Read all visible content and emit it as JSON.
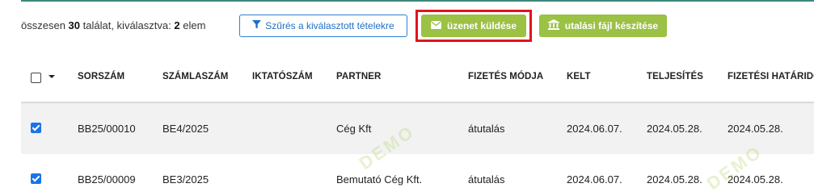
{
  "summary": {
    "prefix": "összesen",
    "total": "30",
    "middle": "találat, kiválasztva:",
    "selected": "2",
    "suffix": "elem"
  },
  "toolbar": {
    "filter_label": "Szűrés a kiválasztott tételekre",
    "filter_icon": "filter-icon",
    "message_label": "üzenet küldése",
    "message_icon": "envelope-icon",
    "file_label": "utalási fájl készítése",
    "file_icon": "bank-icon"
  },
  "table": {
    "headers": [
      "SORSZÁM",
      "SZÁMLASZÁM",
      "IKTATÓSZÁM",
      "PARTNER",
      "FIZETÉS MÓDJA",
      "KELT",
      "TELJESÍTÉS",
      "FIZETÉSI HATÁRIDŐ"
    ],
    "rows": [
      {
        "checked": true,
        "sorszam": "BB25/00010",
        "szamlaszam": "BE4/2025",
        "iktatoszam": "",
        "partner": "Cég Kft",
        "fizetes_modja": "átutalás",
        "kelt": "2024.06.07.",
        "teljesites": "2024.05.28.",
        "hatarido": "2024.05.28."
      },
      {
        "checked": true,
        "sorszam": "BB25/00009",
        "szamlaszam": "BE3/2025",
        "iktatoszam": "",
        "partner": "Bemutató Cég Kft.",
        "fizetes_modja": "átutalás",
        "kelt": "2024.06.07.",
        "teljesites": "2024.05.28.",
        "hatarido": "2024.05.28."
      }
    ]
  },
  "colors": {
    "accent_green": "#9bc145",
    "highlight_red": "#e0141e",
    "filter_blue": "#2c7fd6",
    "checkbox_blue": "#1a73e8"
  }
}
